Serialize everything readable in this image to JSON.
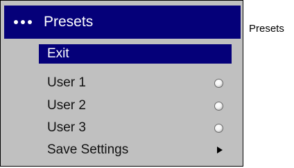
{
  "menu": {
    "title": "Presets",
    "items": [
      {
        "label": "Exit",
        "selected": true,
        "control": "none"
      },
      {
        "label": "User 1",
        "selected": false,
        "control": "radio"
      },
      {
        "label": "User 2",
        "selected": false,
        "control": "radio"
      },
      {
        "label": "User 3",
        "selected": false,
        "control": "radio"
      },
      {
        "label": "Save Settings",
        "selected": false,
        "control": "arrow"
      }
    ]
  },
  "caption": "Presets",
  "colors": {
    "title_bar": "#050079",
    "menu_bg": "#c0c0c0",
    "highlight": "#050079"
  }
}
